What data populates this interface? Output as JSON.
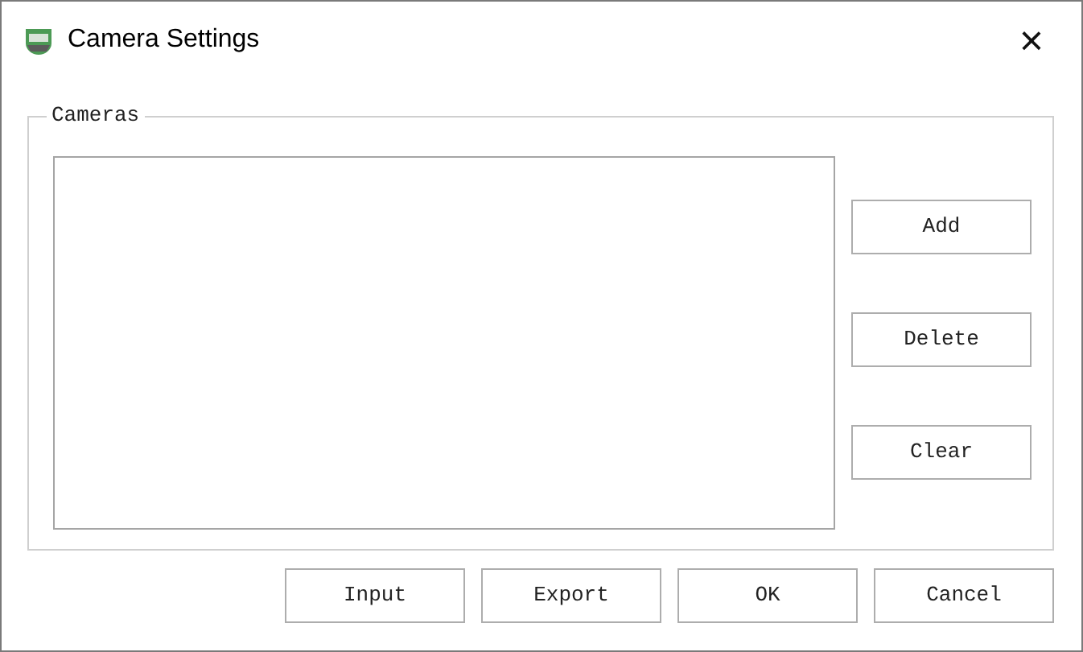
{
  "window": {
    "title": "Camera Settings",
    "close": "×"
  },
  "cameras_group": {
    "label": "Cameras",
    "side_buttons": [
      "Add",
      "Delete",
      "Clear"
    ]
  },
  "buttons": [
    "Input",
    "Export",
    "OK",
    "Cancel"
  ]
}
